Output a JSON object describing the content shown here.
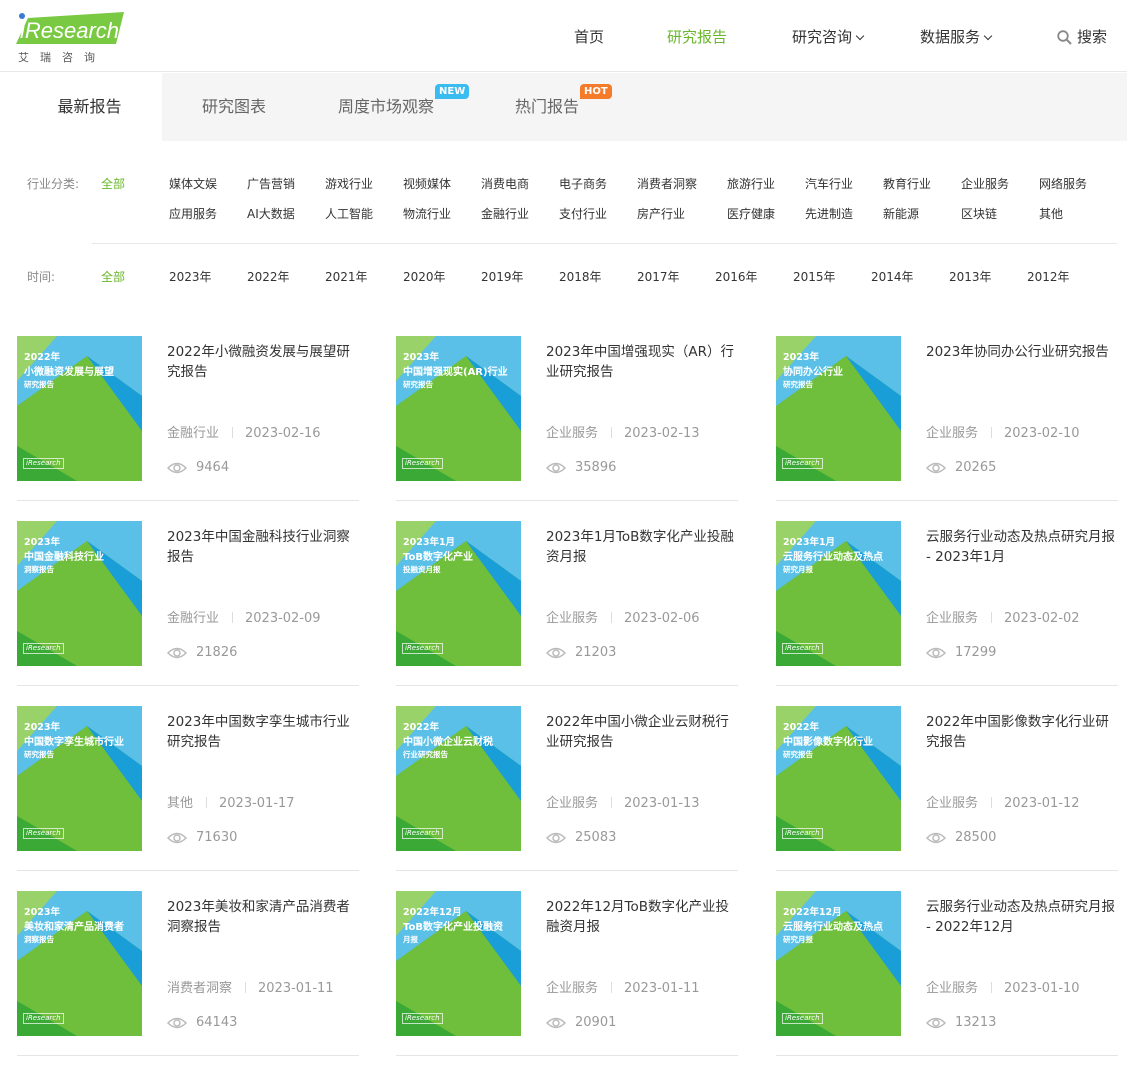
{
  "logo": {
    "brand": "iResearch",
    "sub": "艾瑞咨询"
  },
  "nav": {
    "items": [
      {
        "label": "首页"
      },
      {
        "label": "研究报告"
      },
      {
        "label": "研究咨询"
      },
      {
        "label": "数据服务"
      }
    ],
    "search_label": "搜索"
  },
  "tabs": {
    "items": [
      {
        "label": "最新报告"
      },
      {
        "label": "研究图表"
      },
      {
        "label": "周度市场观察",
        "badge": "NEW"
      },
      {
        "label": "热门报告",
        "badge": "HOT"
      }
    ]
  },
  "filters": {
    "industry_label": "行业分类:",
    "industry_options": [
      "全部",
      "媒体文娱",
      "广告营销",
      "游戏行业",
      "视频媒体",
      "消费电商",
      "电子商务",
      "消费者洞察",
      "旅游行业",
      "汽车行业",
      "教育行业",
      "企业服务",
      "网络服务",
      "应用服务",
      "AI大数据",
      "人工智能",
      "物流行业",
      "金融行业",
      "支付行业",
      "房产行业",
      "医疗健康",
      "先进制造",
      "新能源",
      "区块链",
      "其他"
    ],
    "time_label": "时间:",
    "time_options": [
      "全部",
      "2023年",
      "2022年",
      "2021年",
      "2020年",
      "2019年",
      "2018年",
      "2017年",
      "2016年",
      "2015年",
      "2014年",
      "2013年",
      "2012年"
    ]
  },
  "colors": {
    "accent": "#6ab72c",
    "new_badge": "#3bbcf0",
    "hot_badge": "#f47b2a"
  },
  "reports": [
    {
      "cover_year": "2022年",
      "cover_title": "小微融资发展与展望",
      "cover_sub": "研究报告",
      "title": "2022年小微融资发展与展望研究报告",
      "category": "金融行业",
      "date": "2023-02-16",
      "views": "9464"
    },
    {
      "cover_year": "2023年",
      "cover_title": "中国增强现实(AR)行业",
      "cover_sub": "研究报告",
      "title": "2023年中国增强现实（AR）行业研究报告",
      "category": "企业服务",
      "date": "2023-02-13",
      "views": "35896"
    },
    {
      "cover_year": "2023年",
      "cover_title": "协同办公行业",
      "cover_sub": "研究报告",
      "title": "2023年协同办公行业研究报告",
      "category": "企业服务",
      "date": "2023-02-10",
      "views": "20265"
    },
    {
      "cover_year": "2023年",
      "cover_title": "中国金融科技行业",
      "cover_sub": "洞察报告",
      "title": "2023年中国金融科技行业洞察报告",
      "category": "金融行业",
      "date": "2023-02-09",
      "views": "21826"
    },
    {
      "cover_year": "2023年1月",
      "cover_title": "ToB数字化产业",
      "cover_sub": "投融资月报",
      "title": "2023年1月ToB数字化产业投融资月报",
      "category": "企业服务",
      "date": "2023-02-06",
      "views": "21203"
    },
    {
      "cover_year": "2023年1月",
      "cover_title": "云服务行业动态及热点",
      "cover_sub": "研究月报",
      "title": "云服务行业动态及热点研究月报 - 2023年1月",
      "category": "企业服务",
      "date": "2023-02-02",
      "views": "17299"
    },
    {
      "cover_year": "2023年",
      "cover_title": "中国数字孪生城市行业",
      "cover_sub": "研究报告",
      "title": "2023年中国数字孪生城市行业研究报告",
      "category": "其他",
      "date": "2023-01-17",
      "views": "71630"
    },
    {
      "cover_year": "2022年",
      "cover_title": "中国小微企业云财税",
      "cover_sub": "行业研究报告",
      "title": "2022年中国小微企业云财税行业研究报告",
      "category": "企业服务",
      "date": "2023-01-13",
      "views": "25083"
    },
    {
      "cover_year": "2022年",
      "cover_title": "中国影像数字化行业",
      "cover_sub": "研究报告",
      "title": "2022年中国影像数字化行业研究报告",
      "category": "企业服务",
      "date": "2023-01-12",
      "views": "28500"
    },
    {
      "cover_year": "2023年",
      "cover_title": "美妆和家清产品消费者",
      "cover_sub": "洞察报告",
      "title": "2023年美妆和家清产品消费者洞察报告",
      "category": "消费者洞察",
      "date": "2023-01-11",
      "views": "64143"
    },
    {
      "cover_year": "2022年12月",
      "cover_title": "ToB数字化产业投融资",
      "cover_sub": "月报",
      "title": "2022年12月ToB数字化产业投融资月报",
      "category": "企业服务",
      "date": "2023-01-11",
      "views": "20901"
    },
    {
      "cover_year": "2022年12月",
      "cover_title": "云服务行业动态及热点",
      "cover_sub": "研究月报",
      "title": "云服务行业动态及热点研究月报 - 2022年12月",
      "category": "企业服务",
      "date": "2023-01-10",
      "views": "13213"
    }
  ]
}
